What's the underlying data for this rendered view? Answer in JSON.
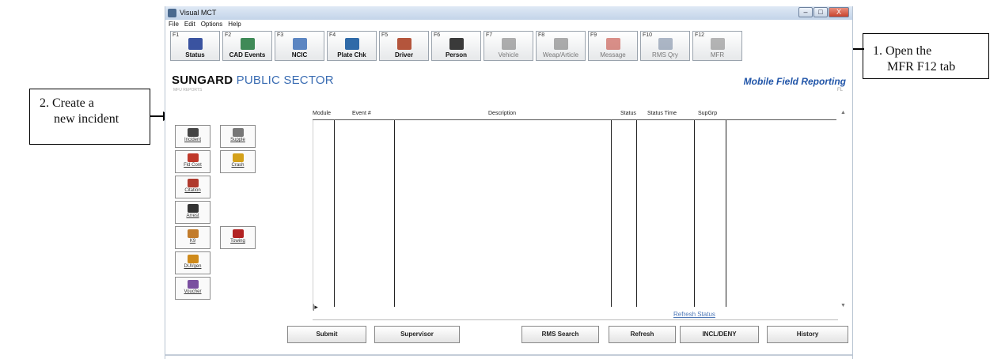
{
  "window": {
    "title": "Visual MCT",
    "menu": [
      "File",
      "Edit",
      "Options",
      "Help"
    ],
    "controls": [
      "–",
      "□",
      "X"
    ]
  },
  "toolbar": [
    {
      "key": "F1",
      "label": "Status",
      "icon": "status-help-icon",
      "color": "#3a53a0",
      "state": "active"
    },
    {
      "key": "F2",
      "label": "CAD Events",
      "icon": "cad-events-icon",
      "color": "#3f8a57",
      "state": "active"
    },
    {
      "key": "F3",
      "label": "NCIC",
      "icon": "ncic-icon",
      "color": "#5c86c2",
      "state": "active"
    },
    {
      "key": "F4",
      "label": "Plate Chk",
      "icon": "plate-check-icon",
      "color": "#2f6aa8",
      "state": "active"
    },
    {
      "key": "F5",
      "label": "Driver",
      "icon": "driver-icon",
      "color": "#b4553c",
      "state": "active"
    },
    {
      "key": "F6",
      "label": "Person",
      "icon": "person-icon",
      "color": "#3a3a3a",
      "state": "active"
    },
    {
      "key": "F7",
      "label": "Vehicle",
      "icon": "vehicle-icon",
      "color": "#707070",
      "state": "dim"
    },
    {
      "key": "F8",
      "label": "Weap/Article",
      "icon": "weapon-icon",
      "color": "#6c6c6c",
      "state": "dim"
    },
    {
      "key": "F9",
      "label": "Message",
      "icon": "message-icon",
      "color": "#c0392b",
      "state": "dim"
    },
    {
      "key": "F10",
      "label": "RMS Qry",
      "icon": "rms-query-icon",
      "color": "#6d7f9a",
      "state": "dim"
    },
    {
      "key": "F12",
      "label": "MFR",
      "icon": "mfr-icon",
      "color": "#7c7c7c",
      "state": "dim"
    }
  ],
  "brand": {
    "primary": "SUNGARD",
    "secondary": "PUBLIC SECTOR",
    "right_title": "Mobile Field Reporting",
    "section": "MFU REPORTS",
    "fl_label": "FL"
  },
  "report_buttons": [
    {
      "label": "Incident",
      "icon": "incident-icon",
      "color": "#444"
    },
    {
      "label": "Supple",
      "icon": "supplement-icon",
      "color": "#777"
    },
    {
      "label": "Fld Cont",
      "icon": "field-contact-icon",
      "color": "#c0392b"
    },
    {
      "label": "Crash",
      "icon": "crash-icon",
      "color": "#d4a11a"
    },
    {
      "label": "Citation",
      "icon": "citation-icon",
      "color": "#b03a2e"
    },
    {
      "label": "Arrest",
      "icon": "arrest-icon",
      "color": "#333"
    },
    {
      "label": "K9",
      "icon": "k9-icon",
      "color": "#c27c2c"
    },
    {
      "label": "Towing",
      "icon": "towing-icon",
      "color": "#b22222"
    },
    {
      "label": "DUI/gen",
      "icon": "dui-icon",
      "color": "#cf8a1a"
    },
    {
      "label": "Voucher",
      "icon": "voucher-icon",
      "color": "#7a4fa0"
    }
  ],
  "grid": {
    "columns": [
      "Module",
      "Event #",
      "Description",
      "Status",
      "Status Time",
      "SupGrp"
    ],
    "rows": []
  },
  "links": {
    "refresh_status": "Refresh Status"
  },
  "bottom_buttons": [
    "Submit",
    "Supervisor",
    "RMS Search",
    "Refresh",
    "INCL/DENY",
    "History"
  ],
  "annotations": {
    "step1_line1": "1. Open the",
    "step1_line2": "MFR F12 tab",
    "step2_line1": "2. Create a",
    "step2_line2": "new incident"
  }
}
